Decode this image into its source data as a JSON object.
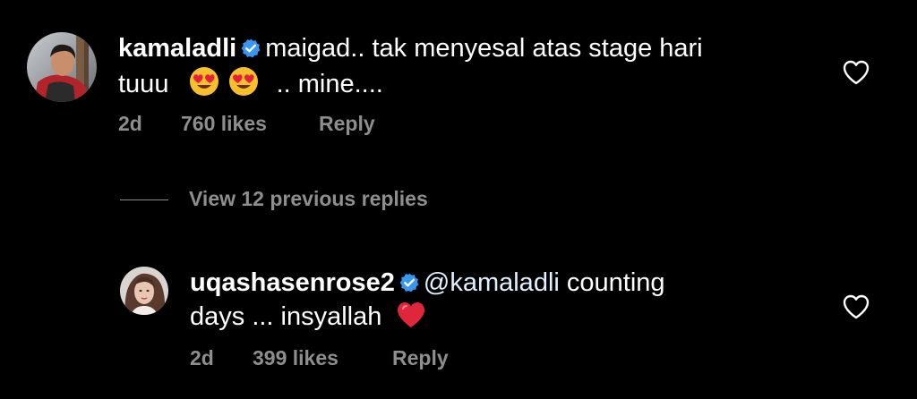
{
  "comment": {
    "username": "kamaladli",
    "text_line1": "maigad.. tak menyesal atas stage hari",
    "text_line2_start": "tuuu",
    "text_line2_end": ".. mine....",
    "emojis": [
      "heart-eyes-emoji",
      "heart-eyes-emoji"
    ],
    "time": "2d",
    "likes": "760 likes",
    "reply_label": "Reply"
  },
  "view_replies": {
    "label": "View 12 previous replies"
  },
  "reply": {
    "username": "uqashasenrose2",
    "mention": "@kamaladli",
    "text_line1": "counting",
    "text_line2": "days ... insyallah",
    "emoji": "red-heart-emoji",
    "time": "2d",
    "likes": "399 likes",
    "reply_label": "Reply"
  },
  "colors": {
    "background": "#000000",
    "text": "#ffffff",
    "secondary": "#8e8e8e",
    "verified": "#3897f0"
  },
  "icons": {
    "like": "heart-outline-icon",
    "verified": "verified-badge-icon"
  }
}
